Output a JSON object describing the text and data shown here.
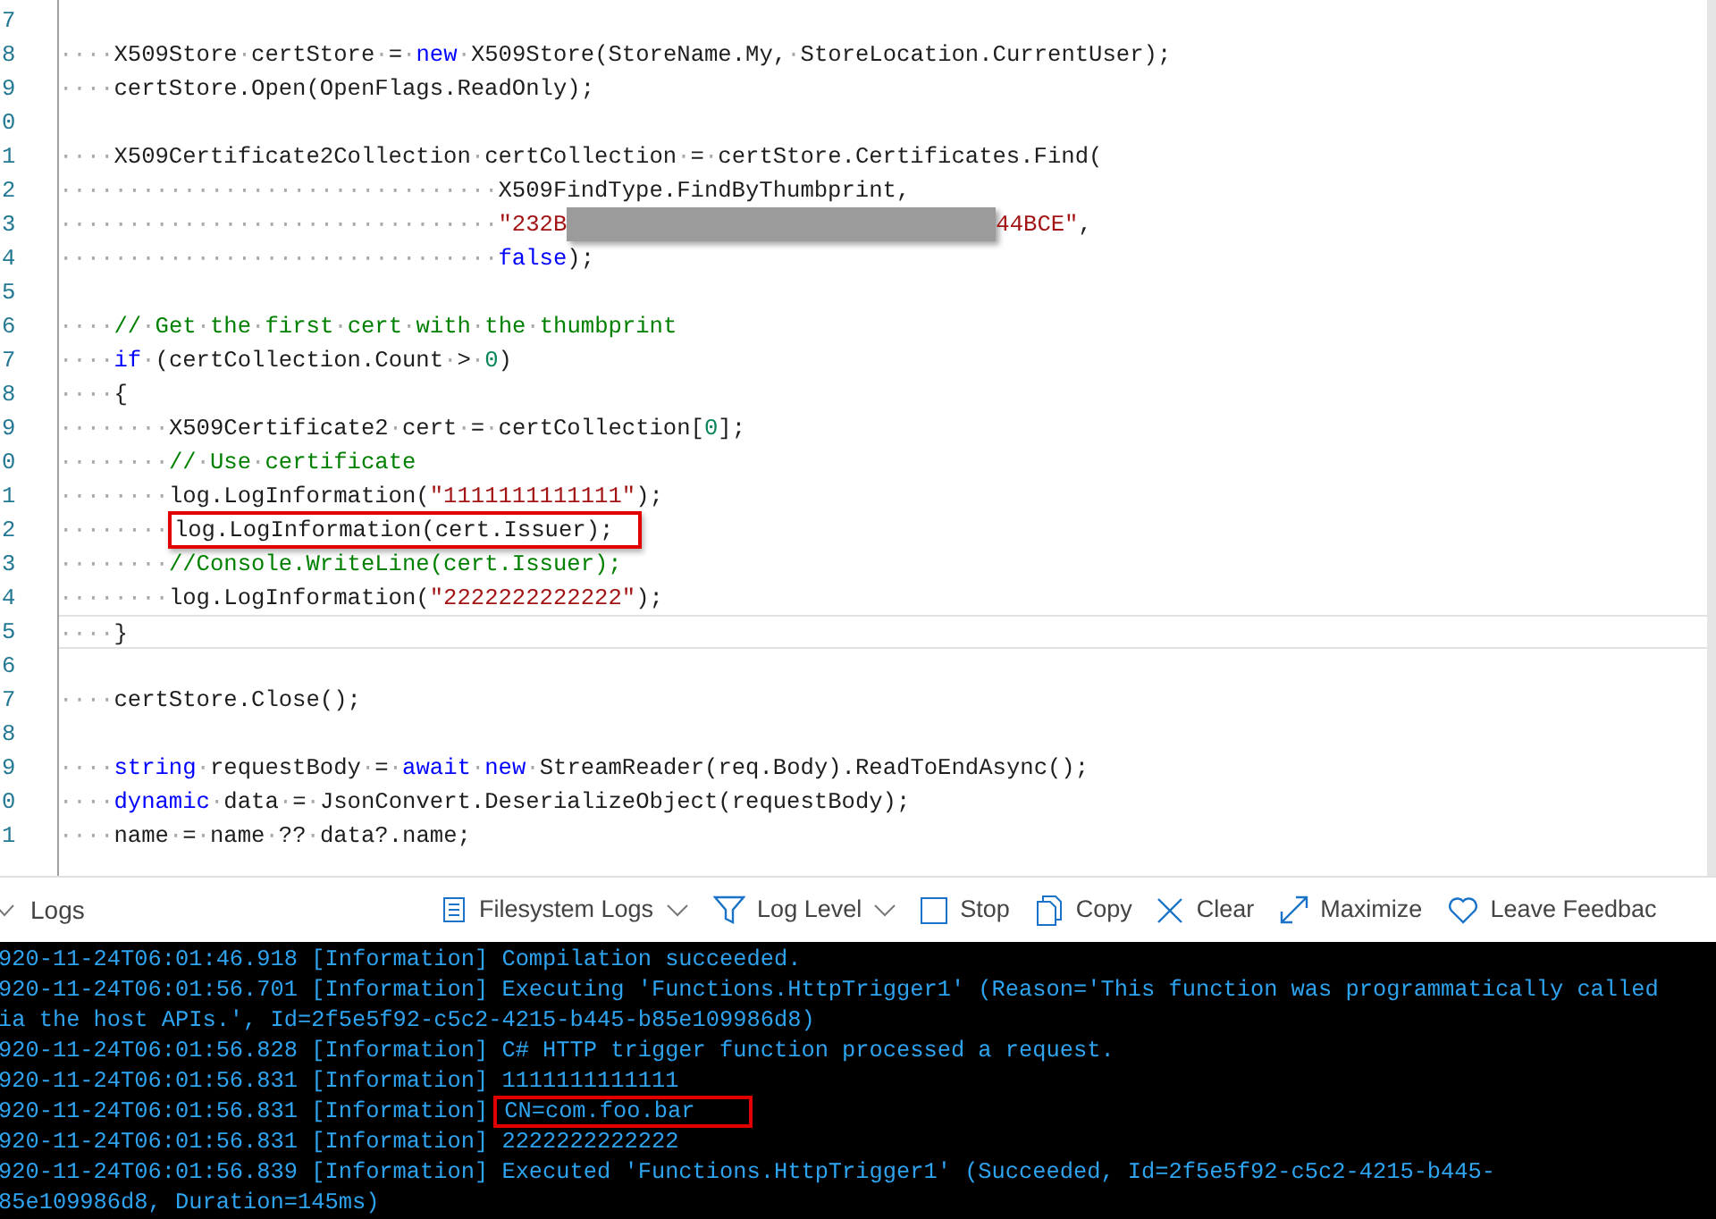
{
  "editor": {
    "lines": [
      {
        "number": "7"
      },
      {
        "number": "8",
        "tokens": [
          {
            "kind": "plain",
            "text": "····X509Store·certStore·=·"
          },
          {
            "kind": "keyword",
            "text": "new"
          },
          {
            "kind": "plain",
            "text": "·X509Store(StoreName.My,·StoreLocation.CurrentUser);"
          }
        ]
      },
      {
        "number": "9",
        "tokens": [
          {
            "kind": "plain",
            "text": "····certStore.Open(OpenFlags.ReadOnly);"
          }
        ]
      },
      {
        "number": "0"
      },
      {
        "number": "1",
        "tokens": [
          {
            "kind": "plain",
            "text": "····X509Certificate2Collection·certCollection·=·certStore.Certificates.Find("
          }
        ]
      },
      {
        "number": "2",
        "tokens": [
          {
            "kind": "plain",
            "text": "································X509FindType.FindByThumbprint,"
          }
        ]
      },
      {
        "number": "3",
        "tokens": [
          {
            "kind": "plain",
            "text": "································"
          },
          {
            "kind": "string",
            "text": "\"232B"
          },
          {
            "kind": "redacted"
          },
          {
            "kind": "string",
            "text": "44BCE\""
          },
          {
            "kind": "plain",
            "text": ","
          }
        ]
      },
      {
        "number": "4",
        "tokens": [
          {
            "kind": "plain",
            "text": "································"
          },
          {
            "kind": "keyword",
            "text": "false"
          },
          {
            "kind": "plain",
            "text": ");"
          }
        ]
      },
      {
        "number": "5"
      },
      {
        "number": "6",
        "tokens": [
          {
            "kind": "plain",
            "text": "····"
          },
          {
            "kind": "comment",
            "text": "//·Get·the·first·cert·with·the·thumbprint"
          }
        ]
      },
      {
        "number": "7",
        "tokens": [
          {
            "kind": "plain",
            "text": "····"
          },
          {
            "kind": "keyword",
            "text": "if"
          },
          {
            "kind": "plain",
            "text": "·(certCollection.Count·>·"
          },
          {
            "kind": "number",
            "text": "0"
          },
          {
            "kind": "plain",
            "text": ")"
          }
        ]
      },
      {
        "number": "8",
        "tokens": [
          {
            "kind": "plain",
            "text": "····{"
          }
        ]
      },
      {
        "number": "9",
        "tokens": [
          {
            "kind": "plain",
            "text": "········X509Certificate2·cert·=·certCollection["
          },
          {
            "kind": "number",
            "text": "0"
          },
          {
            "kind": "plain",
            "text": "];"
          }
        ]
      },
      {
        "number": "0",
        "tokens": [
          {
            "kind": "plain",
            "text": "········"
          },
          {
            "kind": "comment",
            "text": "//·Use·certificate"
          }
        ]
      },
      {
        "number": "1",
        "tokens": [
          {
            "kind": "plain",
            "text": "········log.LogInformation("
          },
          {
            "kind": "string",
            "text": "\"1111111111111\""
          },
          {
            "kind": "plain",
            "text": ");"
          }
        ]
      },
      {
        "number": "2",
        "highlighted": true,
        "tokens": [
          {
            "kind": "plain",
            "text": "········"
          },
          {
            "kind": "plain",
            "text": "log.LogInformation(cert.Issuer);"
          }
        ]
      },
      {
        "number": "3",
        "tokens": [
          {
            "kind": "plain",
            "text": "········"
          },
          {
            "kind": "comment",
            "text": "//Console.WriteLine(cert.Issuer);"
          }
        ]
      },
      {
        "number": "4",
        "tokens": [
          {
            "kind": "plain",
            "text": "········log.LogInformation("
          },
          {
            "kind": "string",
            "text": "\"2222222222222\""
          },
          {
            "kind": "plain",
            "text": ");"
          }
        ]
      },
      {
        "number": "5",
        "current": true,
        "tokens": [
          {
            "kind": "plain",
            "text": "····}"
          }
        ]
      },
      {
        "number": "6"
      },
      {
        "number": "7",
        "tokens": [
          {
            "kind": "plain",
            "text": "····certStore.Close();"
          }
        ]
      },
      {
        "number": "8"
      },
      {
        "number": "9",
        "tokens": [
          {
            "kind": "plain",
            "text": "····"
          },
          {
            "kind": "keyword",
            "text": "string"
          },
          {
            "kind": "plain",
            "text": "·requestBody·=·"
          },
          {
            "kind": "keyword",
            "text": "await"
          },
          {
            "kind": "plain",
            "text": "·"
          },
          {
            "kind": "keyword",
            "text": "new"
          },
          {
            "kind": "plain",
            "text": "·StreamReader(req.Body).ReadToEndAsync();"
          }
        ]
      },
      {
        "number": "0",
        "tokens": [
          {
            "kind": "plain",
            "text": "····"
          },
          {
            "kind": "keyword",
            "text": "dynamic"
          },
          {
            "kind": "plain",
            "text": "·data·=·JsonConvert.DeserializeObject(requestBody);"
          }
        ]
      },
      {
        "number": "1",
        "tokens": [
          {
            "kind": "plain",
            "text": "····name·=·name·??·data?.name;"
          }
        ]
      }
    ]
  },
  "logs_toolbar": {
    "title": "Logs",
    "actions": [
      {
        "kind": "dropdown",
        "label": "Filesystem Logs"
      },
      {
        "kind": "dropdown",
        "label": "Log Level"
      },
      {
        "kind": "button",
        "label": "Stop"
      },
      {
        "kind": "button",
        "label": "Copy"
      },
      {
        "kind": "button",
        "label": "Clear"
      },
      {
        "kind": "button",
        "label": "Maximize"
      },
      {
        "kind": "button",
        "label": "Leave Feedbac"
      }
    ]
  },
  "console": {
    "lines": [
      {
        "kind": "entry",
        "prefix": "920-11-24T06:01:46.918 [Information]",
        "message": "Compilation succeeded."
      },
      {
        "kind": "entry",
        "prefix": "920-11-24T06:01:56.701 [Information]",
        "message": "Executing 'Functions.HttpTrigger1' (Reason='This function was programmatically called"
      },
      {
        "kind": "continuation",
        "message": "ia the host APIs.', Id=2f5e5f92-c5c2-4215-b445-b85e109986d8)"
      },
      {
        "kind": "entry",
        "prefix": "920-11-24T06:01:56.828 [Information]",
        "message": "C# HTTP trigger function processed a request."
      },
      {
        "kind": "entry",
        "prefix": "920-11-24T06:01:56.831 [Information]",
        "message": "1111111111111"
      },
      {
        "kind": "entry",
        "prefix": "920-11-24T06:01:56.831 [Information]",
        "message": "CN=com.foo.bar",
        "highlighted": true
      },
      {
        "kind": "entry",
        "prefix": "920-11-24T06:01:56.831 [Information]",
        "message": "2222222222222"
      },
      {
        "kind": "entry",
        "prefix": "920-11-24T06:01:56.839 [Information]",
        "message": "Executed 'Functions.HttpTrigger1' (Succeeded, Id=2f5e5f92-c5c2-4215-b445-"
      },
      {
        "kind": "continuation",
        "message": "85e109986d8, Duration=145ms)"
      }
    ]
  }
}
